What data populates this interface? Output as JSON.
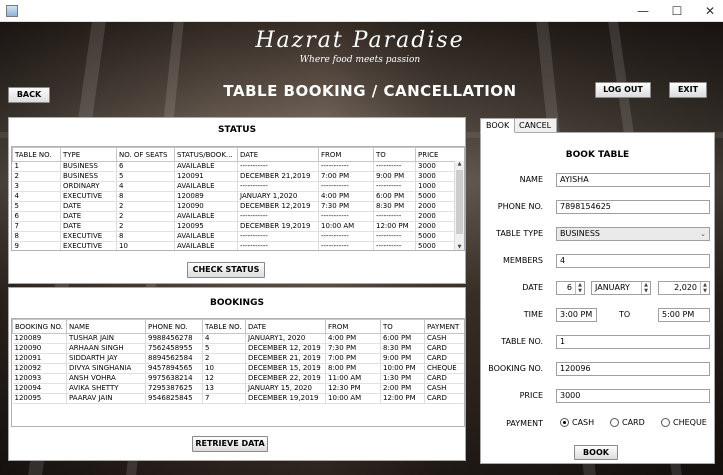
{
  "window": {
    "minimize": "—",
    "maximize": "☐",
    "close": "✕"
  },
  "brand": {
    "name": "Hazrat Paradise",
    "tagline": "Where food meets passion"
  },
  "page_title": "TABLE BOOKING / CANCELLATION",
  "buttons": {
    "back": "BACK",
    "logout": "LOG OUT",
    "exit": "EXIT",
    "check_status": "CHECK STATUS",
    "retrieve": "RETRIEVE DATA",
    "book": "BOOK"
  },
  "status": {
    "title": "STATUS",
    "columns": [
      "TABLE NO.",
      "TYPE",
      "NO. OF SEATS",
      "STATUS/BOOK...",
      "DATE",
      "FROM",
      "TO",
      "PRICE"
    ],
    "rows": [
      [
        "1",
        "BUSINESS",
        "6",
        "AVAILABLE",
        "-----------",
        "-----------",
        "----------",
        "3000"
      ],
      [
        "2",
        "BUSINESS",
        "5",
        "120091",
        "DECEMBER 21,2019",
        "7:00 PM",
        "9:00 PM",
        "3000"
      ],
      [
        "3",
        "ORDINARY",
        "4",
        "AVAILABLE",
        "-----------",
        "-----------",
        "----------",
        "1000"
      ],
      [
        "4",
        "EXECUTIVE",
        "8",
        "120089",
        "JANUARY 1,2020",
        "4:00 PM",
        "6:00 PM",
        "5000"
      ],
      [
        "5",
        "DATE",
        "2",
        "120090",
        "DECEMBER 12,2019",
        "7:30 PM",
        "8:30 PM",
        "2000"
      ],
      [
        "6",
        "DATE",
        "2",
        "AVAILABLE",
        "-----------",
        "-----------",
        "----------",
        "2000"
      ],
      [
        "7",
        "DATE",
        "2",
        "120095",
        "DECEMBER 19,2019",
        "10:00 AM",
        "12:00 PM",
        "2000"
      ],
      [
        "8",
        "EXECUTIVE",
        "8",
        "AVAILABLE",
        "-----------",
        "-----------",
        "----------",
        "5000"
      ],
      [
        "9",
        "EXECUTIVE",
        "10",
        "AVAILABLE",
        "-----------",
        "-----------",
        "----------",
        "5000"
      ]
    ]
  },
  "bookings": {
    "title": "BOOKINGS",
    "columns": [
      "BOOKING NO.",
      "NAME",
      "PHONE NO.",
      "TABLE NO.",
      "DATE",
      "FROM",
      "TO",
      "PAYMENT"
    ],
    "rows": [
      [
        "120089",
        "TUSHAR JAIN",
        "9988456278",
        "4",
        "JANUARY1, 2020",
        "4:00 PM",
        "6:00 PM",
        "CASH"
      ],
      [
        "120090",
        "ARHAAN SINGH",
        "7562458955",
        "5",
        "DECEMBER 12, 2019",
        "7:30 PM",
        "8:30 PM",
        "CARD"
      ],
      [
        "120091",
        "SIDDARTH JAY",
        "8894562584",
        "2",
        "DECEMBER 21, 2019",
        "7:00 PM",
        "9:00 PM",
        "CARD"
      ],
      [
        "120092",
        "DIVYA SINGHANIA",
        "9457894565",
        "10",
        "DECEMBER 15, 2019",
        "8:00 PM",
        "10:00 PM",
        "CHEQUE"
      ],
      [
        "120093",
        "ANSH VOHRA",
        "9975638214",
        "12",
        "DECEMBER 22, 2019",
        "11:00 AM",
        "1:30 PM",
        "CARD"
      ],
      [
        "120094",
        "AVIKA SHETTY",
        "7295387625",
        "13",
        "JANUARY 15, 2020",
        "12:30 PM",
        "2:00 PM",
        "CASH"
      ],
      [
        "120095",
        "PAARAV JAIN",
        "9546825845",
        "7",
        "DECEMBER 19,2019",
        "10:00 AM",
        "12:00 PM",
        "CARD"
      ]
    ]
  },
  "tabs": [
    "BOOK",
    "CANCEL"
  ],
  "form": {
    "title": "BOOK TABLE",
    "name_label": "NAME",
    "name": "AYISHA",
    "phone_label": "PHONE NO.",
    "phone": "7898154625",
    "type_label": "TABLE TYPE",
    "type": "BUSINESS",
    "members_label": "MEMBERS",
    "members": "4",
    "date_label": "DATE",
    "day": "6",
    "month": "JANUARY",
    "year": "2,020",
    "time_label": "TIME",
    "time_from": "3:00 PM",
    "to_label": "TO",
    "time_to": "5:00 PM",
    "table_label": "TABLE NO.",
    "table_no": "1",
    "booking_label": "BOOKING NO.",
    "booking_no": "120096",
    "price_label": "PRICE",
    "price": "3000",
    "payment_label": "PAYMENT",
    "pay_options": [
      "CASH",
      "CARD",
      "CHEQUE"
    ],
    "pay_selected": "CASH"
  }
}
